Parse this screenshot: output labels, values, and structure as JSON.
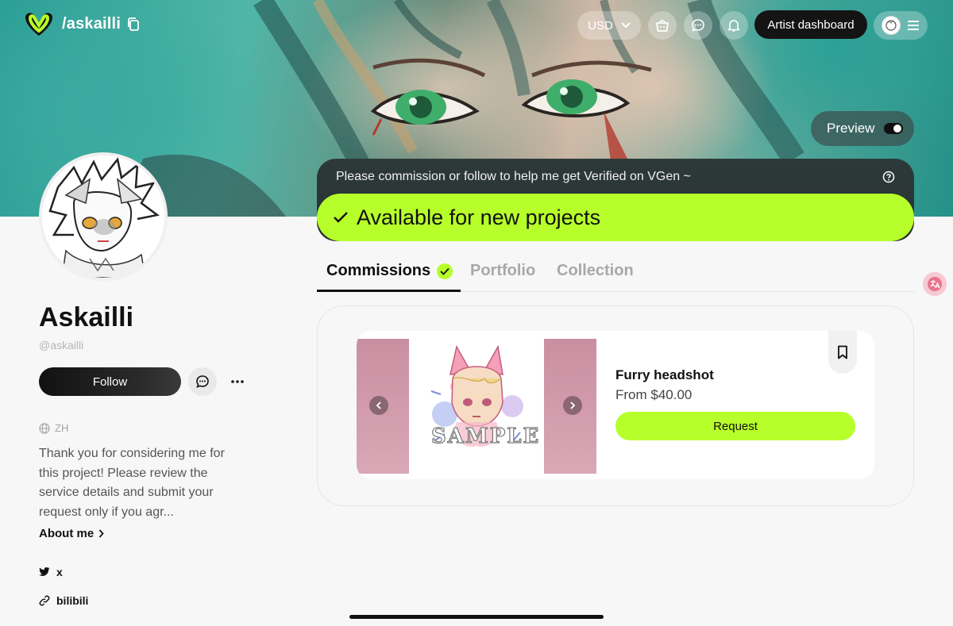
{
  "header": {
    "handle": "/askailli",
    "currency": "USD",
    "artist_dashboard_label": "Artist dashboard"
  },
  "banner": {
    "preview_label": "Preview",
    "notice": "Please commission or follow to help me get Verified on VGen ~",
    "availability": "Available for new projects"
  },
  "profile": {
    "name": "Askailli",
    "username": "@askailli",
    "follow_label": "Follow",
    "language": "ZH",
    "bio": "Thank you for considering me for this project! Please review the service details and submit your request only if you agr...",
    "about_label": "About me",
    "links": [
      {
        "label": "x",
        "icon": "twitter-icon"
      },
      {
        "label": "bilibili",
        "icon": "link-icon"
      }
    ]
  },
  "tabs": [
    {
      "label": "Commissions",
      "active": true
    },
    {
      "label": "Portfolio",
      "active": false
    },
    {
      "label": "Collection",
      "active": false
    }
  ],
  "commission": {
    "title": "Furry headshot",
    "price": "From $40.00",
    "request_label": "Request",
    "sample_watermark": "SAMPLE"
  },
  "colors": {
    "accent_lime": "#b7ff2a",
    "dark": "#141414",
    "muted_text": "#a8a8a8"
  }
}
